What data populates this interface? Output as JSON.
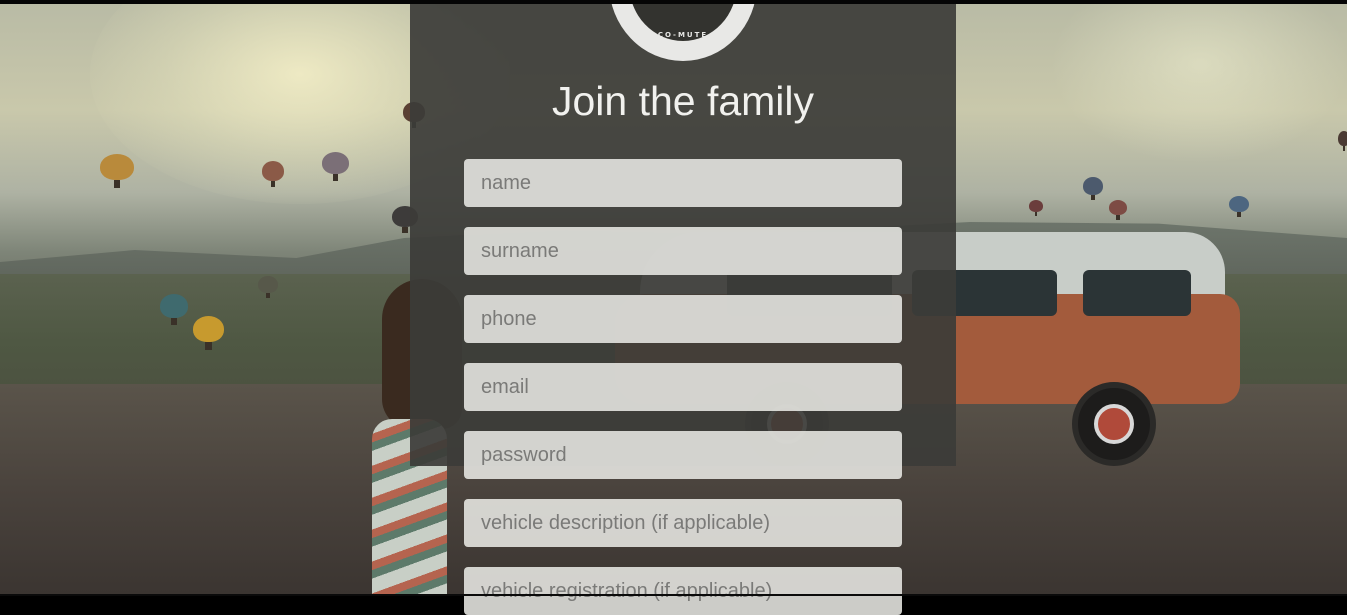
{
  "logo": {
    "text": "CO-MUTE"
  },
  "heading": "Join the family",
  "form": {
    "fields": [
      {
        "placeholder": "name"
      },
      {
        "placeholder": "surname"
      },
      {
        "placeholder": "phone"
      },
      {
        "placeholder": "email"
      },
      {
        "placeholder": "password"
      },
      {
        "placeholder": "vehicle description (if applicable)"
      },
      {
        "placeholder": "vehicle registration (if applicable)"
      }
    ]
  },
  "colors": {
    "panel": "#3c3c38",
    "input_bg": "#e8e8e4",
    "heading_text": "#f1f1ee"
  }
}
